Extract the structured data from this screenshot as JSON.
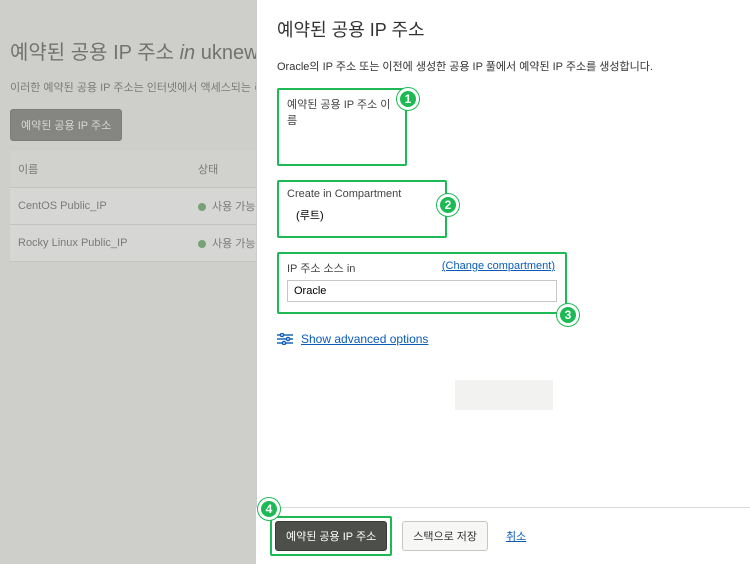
{
  "page": {
    "title_prefix": "예약된 공용 IP 주소 ",
    "title_in": "in",
    "title_suffix": " uknew",
    "subtitle": "이러한 예약된 공용 IP 주소는 인터넷에서 액세스되는 리",
    "list_button": "예약된 공용 IP 주소"
  },
  "table": {
    "col_name": "이름",
    "col_status": "상태",
    "rows": [
      {
        "name": "CentOS Public_IP",
        "status": "사용 가능"
      },
      {
        "name": "Rocky Linux Public_IP",
        "status": "사용 가능"
      }
    ]
  },
  "panel": {
    "title": "예약된 공용 IP 주소",
    "desc": "Oracle의 IP 주소 또는 이전에 생성한 공용 IP 풀에서 예약된 IP 주소를 생성합니다.",
    "name_label": "예약된 공용 IP 주소 이름",
    "name_value": "",
    "compartment_label": "Create in Compartment",
    "compartment_value": " (루트)",
    "source_label": "IP 주소 소스 in",
    "source_value": "Oracle",
    "change_compartment": "(Change compartment)",
    "advanced": "Show advanced options",
    "badge1": "1",
    "badge2": "2",
    "badge3": "3",
    "badge4": "4"
  },
  "actions": {
    "primary": "예약된 공용 IP 주소",
    "secondary": "스택으로 저장",
    "cancel": "취소"
  }
}
